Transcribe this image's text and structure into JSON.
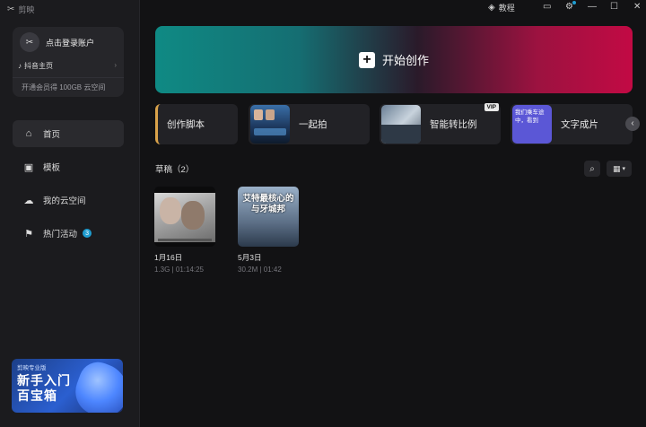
{
  "app": {
    "name": "剪映"
  },
  "topbar": {
    "tutorial_label": "教程"
  },
  "account": {
    "login_label": "点击登录账户",
    "douyin_label": "抖音主页",
    "member_text": "开通会员得 100GB 云空间"
  },
  "nav": [
    {
      "label": "首页",
      "icon": "home-icon",
      "active": true
    },
    {
      "label": "模板",
      "icon": "template-icon"
    },
    {
      "label": "我的云空间",
      "icon": "cloud-icon"
    },
    {
      "label": "热门活动",
      "icon": "flag-icon",
      "badge": "3"
    }
  ],
  "promo": {
    "top_text": "剪映专业版",
    "title": "新手入门百宝箱"
  },
  "hero": {
    "label": "开始创作"
  },
  "quick_actions": [
    {
      "label": "创作脚本"
    },
    {
      "label": "一起拍"
    },
    {
      "label": "智能转比例",
      "badge": "VIP"
    },
    {
      "label": "文字成片",
      "thumb_text": "我们乘车途中，看到"
    }
  ],
  "drafts": {
    "title": "草稿（2）",
    "items": [
      {
        "name": "1月16日",
        "meta": "1.3G | 01:14:25"
      },
      {
        "name": "5月3日",
        "meta": "30.2M | 01:42",
        "overlay": "艾特最核心的与牙城邦"
      }
    ]
  },
  "colors": {
    "hero_start": "#0f8a84",
    "hero_end": "#c20a44",
    "badge": "#1f9dd0",
    "script_accent": "#d9a24a"
  }
}
